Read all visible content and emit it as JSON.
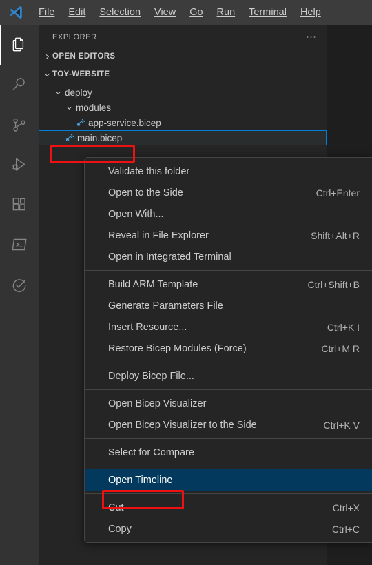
{
  "titlebar": {
    "logo_icon": "vscode-logo-icon",
    "menus": [
      {
        "label": "File",
        "mnemonic": "F"
      },
      {
        "label": "Edit",
        "mnemonic": "E"
      },
      {
        "label": "Selection",
        "mnemonic": "S"
      },
      {
        "label": "View",
        "mnemonic": "V"
      },
      {
        "label": "Go",
        "mnemonic": "G"
      },
      {
        "label": "Run",
        "mnemonic": "R"
      },
      {
        "label": "Terminal",
        "mnemonic": "T"
      },
      {
        "label": "Help",
        "mnemonic": "H"
      }
    ]
  },
  "activitybar": {
    "items": [
      {
        "name": "explorer",
        "icon": "files-icon",
        "active": true
      },
      {
        "name": "search",
        "icon": "search-icon",
        "active": false
      },
      {
        "name": "source-control",
        "icon": "source-control-icon",
        "active": false
      },
      {
        "name": "run-and-debug",
        "icon": "run-debug-icon",
        "active": false
      },
      {
        "name": "extensions",
        "icon": "extensions-icon",
        "active": false
      },
      {
        "name": "azure",
        "icon": "terminal-prompt-icon",
        "active": false
      },
      {
        "name": "testing",
        "icon": "testing-checkmark-icon",
        "active": false
      }
    ]
  },
  "sidebar": {
    "title": "EXPLORER",
    "more_actions_icon": "ellipsis-icon",
    "open_editors": {
      "label": "OPEN EDITORS",
      "expanded": false
    },
    "workspace": {
      "label": "TOY-WEBSITE",
      "expanded": true
    },
    "tree": [
      {
        "label": "deploy",
        "type": "folder",
        "expanded": true,
        "depth": 1
      },
      {
        "label": "modules",
        "type": "folder",
        "expanded": true,
        "depth": 2
      },
      {
        "label": "app-service.bicep",
        "type": "file",
        "icon": "bicep-file-icon",
        "depth": 3
      },
      {
        "label": "main.bicep",
        "type": "file",
        "icon": "bicep-file-icon",
        "depth": 2,
        "focused": true
      }
    ]
  },
  "context_menu": {
    "groups": [
      [
        {
          "label": "Validate this folder",
          "shortcut": ""
        },
        {
          "label": "Open to the Side",
          "shortcut": "Ctrl+Enter"
        },
        {
          "label": "Open With...",
          "shortcut": ""
        },
        {
          "label": "Reveal in File Explorer",
          "shortcut": "Shift+Alt+R"
        },
        {
          "label": "Open in Integrated Terminal",
          "shortcut": ""
        }
      ],
      [
        {
          "label": "Build ARM Template",
          "shortcut": "Ctrl+Shift+B"
        },
        {
          "label": "Generate Parameters File",
          "shortcut": ""
        },
        {
          "label": "Insert Resource...",
          "shortcut": "Ctrl+K I"
        },
        {
          "label": "Restore Bicep Modules (Force)",
          "shortcut": "Ctrl+M R"
        }
      ],
      [
        {
          "label": "Deploy Bicep File...",
          "shortcut": ""
        }
      ],
      [
        {
          "label": "Open Bicep Visualizer",
          "shortcut": ""
        },
        {
          "label": "Open Bicep Visualizer to the Side",
          "shortcut": "Ctrl+K V"
        }
      ],
      [
        {
          "label": "Select for Compare",
          "shortcut": ""
        }
      ],
      [
        {
          "label": "Open Timeline",
          "shortcut": "",
          "selected": true
        }
      ],
      [
        {
          "label": "Cut",
          "shortcut": "Ctrl+X"
        },
        {
          "label": "Copy",
          "shortcut": "Ctrl+C"
        }
      ]
    ]
  },
  "annotations": [
    {
      "name": "main-bicep-highlight",
      "target": "main.bicep"
    },
    {
      "name": "open-timeline-highlight",
      "target": "Open Timeline"
    }
  ],
  "colors": {
    "accent": "#007fd4",
    "selection": "#04395e",
    "annotation": "#ee1111",
    "bicep_icon": "#4a9fd5",
    "titlebar_bg": "#3c3c3c",
    "activitybar_bg": "#333333",
    "sidebar_bg": "#252526",
    "editor_bg": "#1e1e1e"
  }
}
